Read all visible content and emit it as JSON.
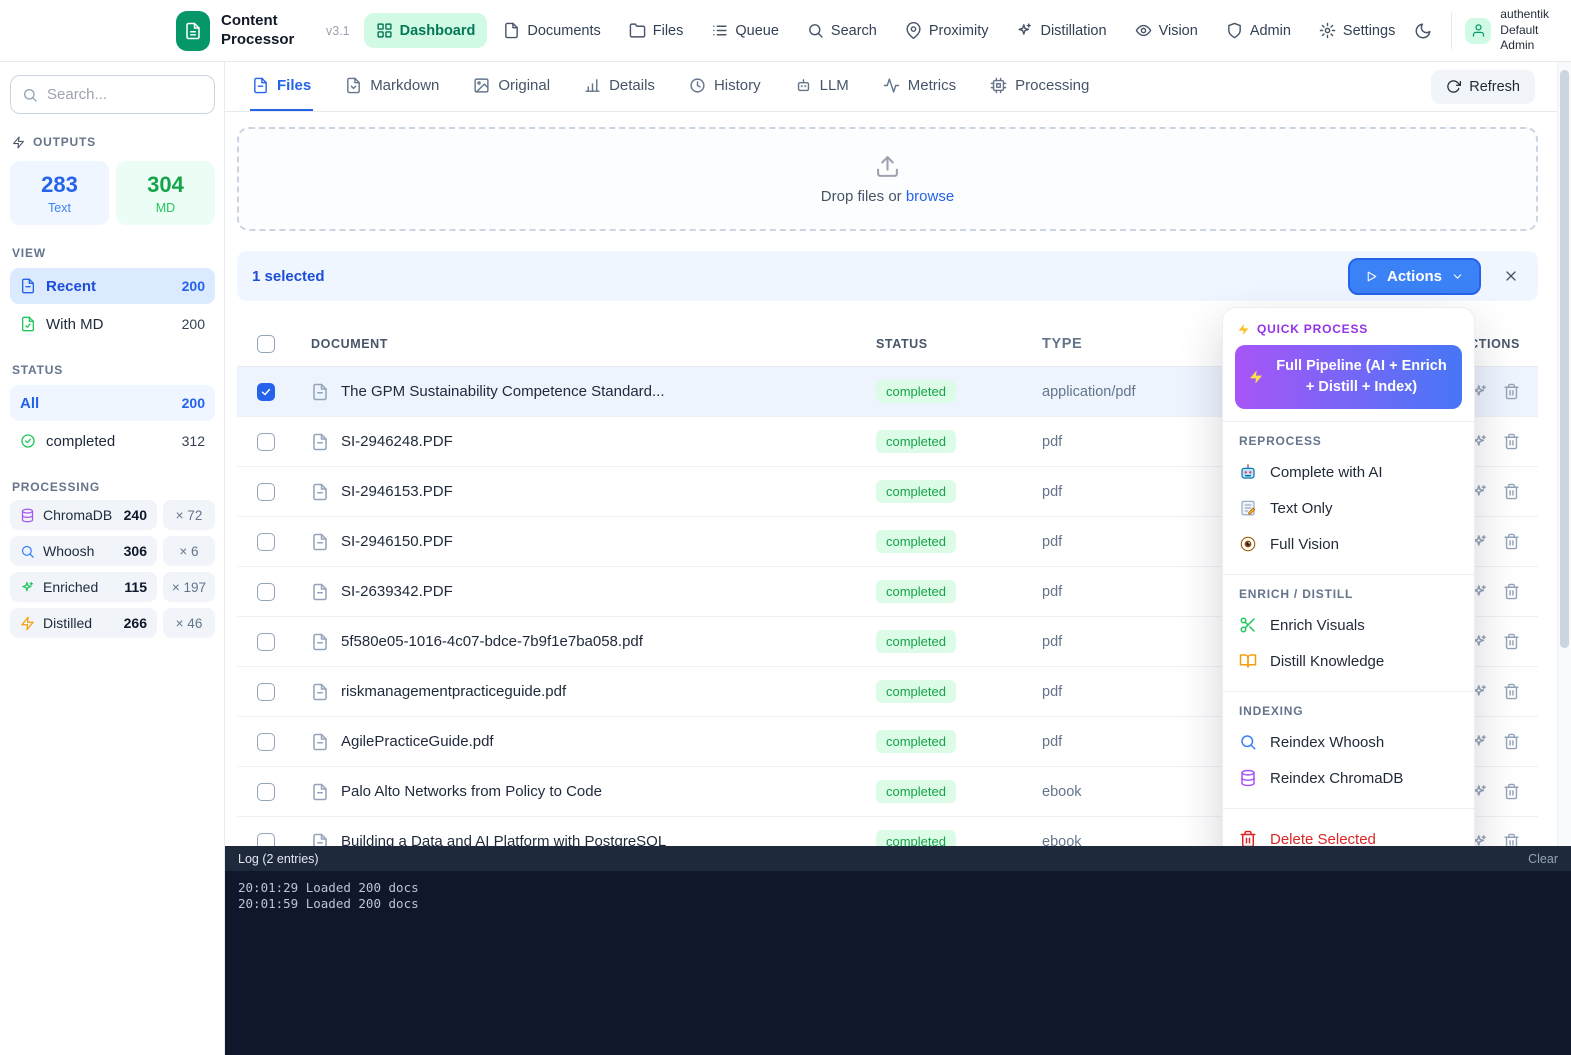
{
  "topbar": {
    "brand_title": "Content Processor",
    "version": "v3.1",
    "nav": [
      {
        "label": "Dashboard",
        "active": true
      },
      {
        "label": "Documents",
        "active": false
      },
      {
        "label": "Files",
        "active": false
      },
      {
        "label": "Queue",
        "active": false
      },
      {
        "label": "Search",
        "active": false
      },
      {
        "label": "Proximity",
        "active": false
      },
      {
        "label": "Distillation",
        "active": false
      },
      {
        "label": "Vision",
        "active": false
      },
      {
        "label": "Admin",
        "active": false
      },
      {
        "label": "Settings",
        "active": false
      }
    ],
    "user": [
      "authentik",
      "Default",
      "Admin"
    ]
  },
  "sidebar": {
    "search_placeholder": "Search...",
    "outputs_header": "OUTPUTS",
    "outputs": {
      "text": {
        "value": "283",
        "label": "Text"
      },
      "md": {
        "value": "304",
        "label": "MD"
      }
    },
    "view_header": "VIEW",
    "view": [
      {
        "label": "Recent",
        "count": "200",
        "active": true
      },
      {
        "label": "With MD",
        "count": "200",
        "active": false
      }
    ],
    "status_header": "STATUS",
    "status": [
      {
        "label": "All",
        "count": "200",
        "active": true
      },
      {
        "label": "completed",
        "count": "312",
        "active": false
      }
    ],
    "processing_header": "PROCESSING",
    "processing": [
      {
        "label": "ChromaDB",
        "count": "240",
        "extra": "× 72",
        "icon": "database"
      },
      {
        "label": "Whoosh",
        "count": "306",
        "extra": "× 6",
        "icon": "search"
      },
      {
        "label": "Enriched",
        "count": "115",
        "extra": "× 197",
        "icon": "sparkles"
      },
      {
        "label": "Distilled",
        "count": "266",
        "extra": "× 46",
        "icon": "zap"
      }
    ]
  },
  "tabsbar": {
    "tabs": [
      {
        "label": "Files",
        "active": true
      },
      {
        "label": "Markdown",
        "active": false
      },
      {
        "label": "Original",
        "active": false
      },
      {
        "label": "Details",
        "active": false
      },
      {
        "label": "History",
        "active": false
      },
      {
        "label": "LLM",
        "active": false
      },
      {
        "label": "Metrics",
        "active": false
      },
      {
        "label": "Processing",
        "active": false
      }
    ],
    "refresh_label": "Refresh"
  },
  "dropzone": {
    "prompt": "Drop files or",
    "browse_label": "browse"
  },
  "selection_bar": {
    "selected_text": "1 selected",
    "actions_label": "Actions"
  },
  "table": {
    "headers": {
      "document": "DOCUMENT",
      "status": "STATUS",
      "type": "TYPE",
      "actions": "ACTIONS"
    },
    "rows": [
      {
        "name": "The GPM Sustainability Competence Standard...",
        "status": "completed",
        "type": "application/pdf",
        "selected": true
      },
      {
        "name": "SI-2946248.PDF",
        "status": "completed",
        "type": "pdf",
        "selected": false
      },
      {
        "name": "SI-2946153.PDF",
        "status": "completed",
        "type": "pdf",
        "selected": false
      },
      {
        "name": "SI-2946150.PDF",
        "status": "completed",
        "type": "pdf",
        "selected": false
      },
      {
        "name": "SI-2639342.PDF",
        "status": "completed",
        "type": "pdf",
        "selected": false
      },
      {
        "name": "5f580e05-1016-4c07-bdce-7b9f1e7ba058.pdf",
        "status": "completed",
        "type": "pdf",
        "selected": false
      },
      {
        "name": "riskmanagementpracticeguide.pdf",
        "status": "completed",
        "type": "pdf",
        "selected": false
      },
      {
        "name": "AgilePracticeGuide.pdf",
        "status": "completed",
        "type": "pdf",
        "selected": false
      },
      {
        "name": "Palo Alto Networks from Policy to Code",
        "status": "completed",
        "type": "ebook",
        "selected": false
      },
      {
        "name": "Building a Data and AI Platform with PostgreSQL",
        "status": "completed",
        "type": "ebook",
        "selected": false
      }
    ]
  },
  "actions_menu": {
    "quick_header": "QUICK PROCESS",
    "full_pipeline_label": "Full Pipeline (AI + Enrich + Distill + Index)",
    "sections": [
      {
        "header": "REPROCESS",
        "items": [
          {
            "label": "Complete with AI",
            "icon": "robot"
          },
          {
            "label": "Text Only",
            "icon": "memo"
          },
          {
            "label": "Full Vision",
            "icon": "eye"
          }
        ]
      },
      {
        "header": "ENRICH / DISTILL",
        "items": [
          {
            "label": "Enrich Visuals",
            "icon": "scissors"
          },
          {
            "label": "Distill Knowledge",
            "icon": "open-book"
          }
        ]
      },
      {
        "header": "INDEXING",
        "items": [
          {
            "label": "Reindex Whoosh",
            "icon": "search"
          },
          {
            "label": "Reindex ChromaDB",
            "icon": "database"
          }
        ]
      }
    ],
    "delete_label": "Delete Selected"
  },
  "log": {
    "title": "Log (2 entries)",
    "clear_label": "Clear",
    "entries": [
      "20:01:29 Loaded 200 docs",
      "20:01:59 Loaded 200 docs"
    ]
  },
  "colors": {
    "brand_green": "#059669",
    "nav_active_bg": "#d1fae5",
    "accent_blue": "#3b82f6",
    "selection_bg": "#eff6ff",
    "status_completed_bg": "#dcfce7",
    "status_completed_text": "#16a34a",
    "quick_process_text": "#9333ea",
    "pipeline_gradient_start": "#a855f7",
    "pipeline_gradient_end": "#4677f6",
    "delete_red": "#dc2626",
    "log_header_bg": "#1e293b",
    "log_body_bg": "#0f172a"
  }
}
